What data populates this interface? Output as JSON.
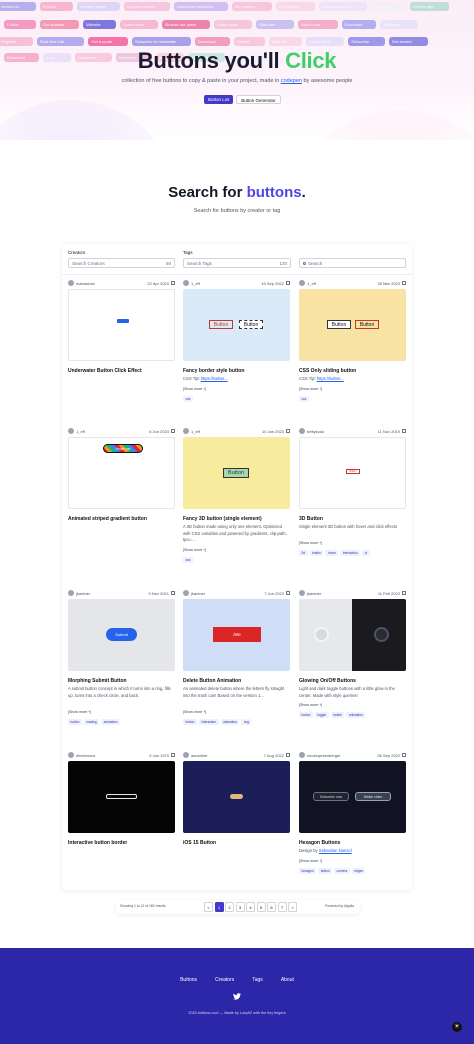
{
  "hero": {
    "title_main": "Buttons you'll ",
    "title_accent": "Click",
    "subtitle_pre": "collection of free buttons to copy & paste in your project, made in ",
    "subtitle_link": "codepen",
    "subtitle_post": " by awesome people",
    "tabs": [
      {
        "label": "Button List",
        "active": true
      },
      {
        "label": "Button Generator",
        "active": false
      }
    ],
    "chips": [
      {
        "label": "contact us",
        "color": "#7c7ce8"
      },
      {
        "label": "Explore",
        "color": "#f68ab0"
      },
      {
        "label": "Browse guides",
        "color": "#c8c2f5"
      },
      {
        "label": "Explore careers",
        "color": "#f3a6c9"
      },
      {
        "label": "Subscribe newsletter",
        "color": "#b497f0"
      },
      {
        "label": "Get started",
        "color": "#f7a7c7"
      },
      {
        "label": "Get Started",
        "color": "#f6c8dd"
      },
      {
        "label": "Browse countries",
        "color": "#e3ddf7"
      },
      {
        "label": "Book now",
        "color": "#f0f0f7"
      },
      {
        "label": "Get the app",
        "color": "#8fd1c4"
      },
      {
        "label": "Follow",
        "color": "#f589b6"
      },
      {
        "label": "Get updates",
        "color": "#f48aa9"
      },
      {
        "label": "Website",
        "color": "#6b63d8"
      },
      {
        "label": "Learn more",
        "color": "#f7b0cc"
      },
      {
        "label": "Browse our plans",
        "color": "#ec6f9e"
      },
      {
        "label": "Learn more",
        "color": "#f5c0d5"
      },
      {
        "label": "Start free",
        "color": "#c2b8f2"
      },
      {
        "label": "Add to cart",
        "color": "#f3a3c2"
      },
      {
        "label": "Download",
        "color": "#a7a3f0"
      },
      {
        "label": "Start free",
        "color": "#e6e1fa"
      },
      {
        "label": "Register",
        "color": "#f6b8cf"
      },
      {
        "label": "Start free trial",
        "color": "#a6a1ee"
      },
      {
        "label": "Get a quote",
        "color": "#f25f9a"
      },
      {
        "label": "Subscribe to newsletter",
        "color": "#9b93e8"
      },
      {
        "label": "Download",
        "color": "#f08fb7"
      },
      {
        "label": "Donate",
        "color": "#f7c2d6"
      },
      {
        "label": "Sign up",
        "color": "#f9d5e3"
      },
      {
        "label": "Learn more",
        "color": "#e2ddf9"
      },
      {
        "label": "Subscribe",
        "color": "#8f88e6"
      },
      {
        "label": "Get started",
        "color": "#7f7ae0"
      },
      {
        "label": "Download",
        "color": "#f37caa"
      },
      {
        "label": "Book",
        "color": "#d9d4f7"
      },
      {
        "label": "Subscribe",
        "color": "#f3aac6"
      },
      {
        "label": "Subscribe",
        "color": "#e2a5c9"
      },
      {
        "label": "Join",
        "color": "#f7bcd1"
      },
      {
        "label": "Subscribe",
        "color": "#a7e0d3"
      },
      {
        "label": "Learn more",
        "color": "#f1eff9"
      }
    ]
  },
  "search": {
    "title_main": "Search for ",
    "title_accent": "buttons",
    "title_end": ".",
    "subtitle": "Search for buttons by creator or tag",
    "creators_label": "Creators",
    "creators_placeholder": "Search Creators",
    "creators_count": "60",
    "tags_label": "Tags",
    "tags_placeholder": "Search Tags",
    "tags_count": "120",
    "search_placeholder": "Search"
  },
  "cards": [
    {
      "author": "mahanban",
      "date": "22 Apr 2020",
      "title": "Underwater Button Click Effect",
      "desc": "",
      "link": "",
      "showmore": "",
      "tags": [],
      "preview": {
        "bg": "#ffffff",
        "kind": "blue-small",
        "labels": []
      }
    },
    {
      "author": "1_eff",
      "date": "16 Sep 2022",
      "title": "Fancy border style button",
      "desc": "CSS Tip! ",
      "link": "https://twitter...",
      "showmore": "[Show more +]",
      "tags": [
        "css"
      ],
      "preview": {
        "bg": "#dbeaf9",
        "kind": "outline-pair",
        "labels": [
          "Button",
          "Button"
        ]
      }
    },
    {
      "author": "1_eff",
      "date": "30 Mar 2023",
      "title": "CSS Only sliding button",
      "desc": "CSS Tip! ",
      "link": "https://twitter...",
      "showmore": "[Show more +]",
      "tags": [
        "css"
      ],
      "preview": {
        "bg": "#f8e3a5",
        "kind": "slide-pair",
        "labels": [
          "Button",
          "Button"
        ]
      }
    },
    {
      "author": "1_eff",
      "date": "6 Jun 2023",
      "title": "Animated striped gradient button",
      "desc": "",
      "link": "",
      "showmore": "",
      "tags": [],
      "preview": {
        "bg": "#ffffff",
        "kind": "striped",
        "labels": [
          "Hover me"
        ]
      }
    },
    {
      "author": "1_eff",
      "date": "10 Jan 2023",
      "title": "Fancy 3D button (single element)",
      "desc": "A 3D button made using only one element. Optimized with CSS variables and powered by gradients, clip-path, tpo=...",
      "link": "",
      "showmore": "[Show more +]",
      "tags": [
        "css"
      ],
      "preview": {
        "bg": "#f7eb9d",
        "kind": "fancy3d",
        "labels": [
          "Button"
        ]
      }
    },
    {
      "author": "bettykudo",
      "date": "11 Nov 2019",
      "title": "3D Button",
      "desc": "Single element 3D button with hover and click effects",
      "link": "",
      "showmore": "[Show more +]",
      "tags": [
        "3d",
        "button",
        "hover",
        "interaction",
        "ui"
      ],
      "preview": {
        "bg": "#ffffff",
        "kind": "small-red",
        "labels": [
          "Button"
        ]
      }
    },
    {
      "author": "jkantner",
      "date": "9 Nov 2021",
      "title": "Morphing Submit Button",
      "desc": "A submit button concept in which it turns into a ring, fills up, turns into a check circle, and back.",
      "link": "",
      "showmore": "[Show more +]",
      "tags": [
        "button",
        "loading",
        "animation"
      ],
      "preview": {
        "bg": "#e4e6ea",
        "kind": "submit",
        "labels": [
          "Submit"
        ]
      }
    },
    {
      "author": "jkantner",
      "date": "7 Jun 2023",
      "title": "Delete Button Animation",
      "desc": "An animated delete button where the letters fly straight into the trash can! Based on the version 1...",
      "link": "",
      "showmore": "[Show more +]",
      "tags": [
        "button",
        "interaction",
        "animation",
        "svg"
      ],
      "preview": {
        "bg": "#cfddf7",
        "kind": "delete",
        "labels": [
          "/ete"
        ]
      }
    },
    {
      "author": "jkantner",
      "date": "11 Feb 2023",
      "title": "Glowing On/Off Buttons",
      "desc": "Light and dark toggle buttons with a little glow in the center. Made with style queries!",
      "link": "",
      "showmore": "[Show more +]",
      "tags": [
        "button",
        "toggle",
        "switch",
        "animation"
      ],
      "preview": {
        "bg": "#e7e8ec",
        "kind": "onoff",
        "labels": []
      }
    },
    {
      "author": "electerious",
      "date": "5 Jan 1970",
      "title": "Interactive button border",
      "desc": "",
      "link": "",
      "showmore": "",
      "tags": [],
      "preview": {
        "bg": "#050505",
        "kind": "dark-border",
        "labels": []
      }
    },
    {
      "author": "aaronlker",
      "date": "7 Aug 2022",
      "title": "iOS 15 Button",
      "desc": "",
      "link": "",
      "showmore": "",
      "tags": [],
      "preview": {
        "bg": "#1c1f57",
        "kind": "ios",
        "labels": []
      }
    },
    {
      "author": "nicolasjesenberger",
      "date": "26 Sep 2022",
      "title": "Hexagon Buttons",
      "desc": "Design by ",
      "link": "Sebastian Nanzel",
      "showmore": "[Show more +]",
      "tags": [
        "hexagon",
        "button",
        "corners",
        "edges"
      ],
      "preview": {
        "bg": "#111322",
        "kind": "hexagon",
        "labels": [
          "Subscribe now",
          "Watch video"
        ]
      }
    }
  ],
  "pagination": {
    "info": "Showing 1 to 12 of 182 results",
    "pages": [
      "<",
      "1",
      "2",
      "3",
      "4",
      "5",
      "6",
      "7",
      ">"
    ],
    "active": "1",
    "powered": "Powered by Algolia"
  },
  "footer": {
    "links": [
      "Buttons",
      "Creators",
      "Tags",
      "About"
    ],
    "copyright": "2023 buttons.cool — Made by Luky92 with the tiny fingers"
  },
  "colors": {
    "accent_green": "#3fce6a",
    "accent_indigo": "#4f46e5",
    "footer_bg": "#2c27a8"
  }
}
